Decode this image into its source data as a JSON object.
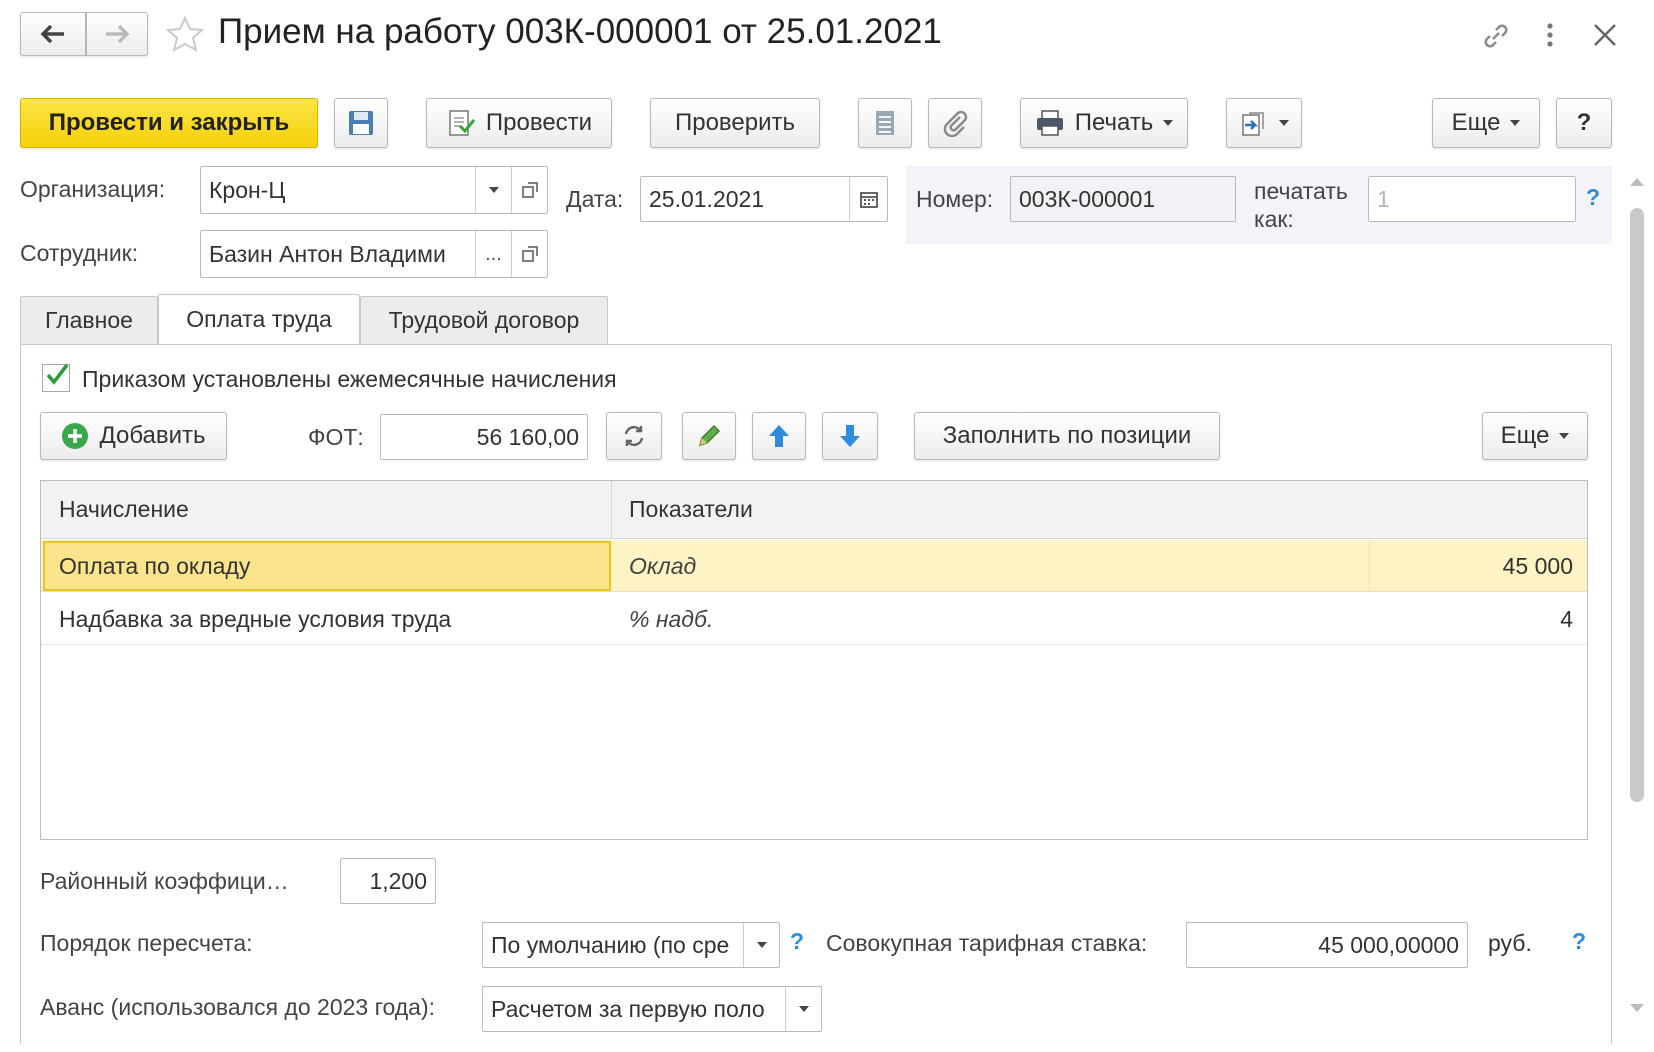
{
  "window": {
    "title": "Прием на работу 003К-000001 от 25.01.2021"
  },
  "toolbar": {
    "post_close": "Провести и закрыть",
    "post": "Провести",
    "check": "Проверить",
    "print": "Печать",
    "more": "Еще",
    "help": "?"
  },
  "header": {
    "org_label": "Организация:",
    "org_value": "Крон-Ц",
    "date_label": "Дата:",
    "date_value": "25.01.2021",
    "number_label": "Номер:",
    "number_value": "003К-000001",
    "print_as_label_1": "печатать",
    "print_as_label_2": "как:",
    "print_as_placeholder": "1",
    "employee_label": "Сотрудник:",
    "employee_value": "Базин Антон Владими",
    "employee_ellipsis": "..."
  },
  "tabs": [
    {
      "label": "Главное"
    },
    {
      "label": "Оплата труда"
    },
    {
      "label": "Трудовой договор"
    }
  ],
  "payroll": {
    "checkbox_label": "Приказом установлены ежемесячные начисления",
    "add_button": "Добавить",
    "fot_label": "ФОТ:",
    "fot_value": "56 160,00",
    "fill_by_position": "Заполнить по позиции",
    "more": "Еще",
    "columns": [
      "Начисление",
      "Показатели"
    ],
    "rows": [
      {
        "accrual": "Оплата по окладу",
        "indicator": "Оклад",
        "value": "45 000"
      },
      {
        "accrual": "Надбавка за вредные условия труда",
        "indicator": "% надб.",
        "value": "4"
      }
    ]
  },
  "footer": {
    "district_coef_label": "Районный коэффици…",
    "district_coef_value": "1,200",
    "recalc_label": "Порядок пересчета:",
    "recalc_value": "По умолчанию (по сре",
    "total_rate_label": "Совокупная тарифная ставка:",
    "total_rate_value": "45 000,00000",
    "currency": "руб.",
    "advance_label": "Аванс (использовался до 2023 года):",
    "advance_value": "Расчетом за первую поло"
  },
  "colors": {
    "accent_yellow": "#f5d10a",
    "selected_row": "#fdf3c4",
    "selected_cell": "#fbe48c",
    "help_blue": "#2c8fd8"
  }
}
